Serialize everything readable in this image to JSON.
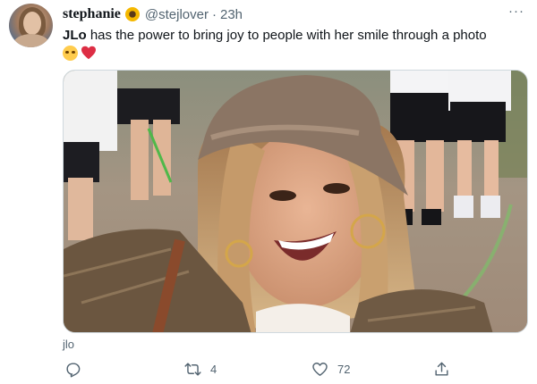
{
  "tweet": {
    "display_name": "stephanie",
    "name_emoji": "sunflower-icon",
    "handle": "@stejlover",
    "separator": "·",
    "time": "23h",
    "more_label": "···",
    "text_bold": "JLo",
    "text_rest": " has the power to bring joy to people with her smile through a photo",
    "text_emojis": [
      "pleading-face-icon",
      "red-heart-icon"
    ],
    "caption": "jlo"
  },
  "actions": {
    "reply_icon": "reply-icon",
    "retweet_icon": "retweet-icon",
    "retweet_count": "4",
    "like_icon": "heart-icon",
    "like_count": "72",
    "share_icon": "share-icon"
  },
  "colors": {
    "text": "#0f1419",
    "secondary": "#536471",
    "heart": "#e0245e",
    "sunflower": "#f5b800"
  }
}
